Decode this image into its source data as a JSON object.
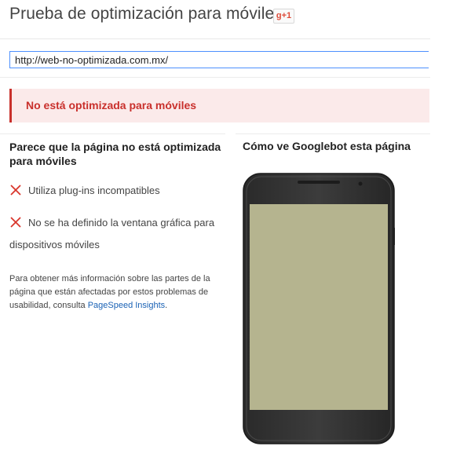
{
  "header": {
    "title": "Prueba de optimización para móviles",
    "gplus_label": "g+1"
  },
  "url_input": {
    "value": "http://web-no-optimizada.com.mx/"
  },
  "alert": {
    "text": "No está optimizada para móviles",
    "color": "#c9302c",
    "background": "#fbeaea"
  },
  "left": {
    "heading": "Parece que la página no está optimizada para móviles",
    "issues": [
      {
        "icon": "x-mark-icon",
        "text": "Utiliza plug-ins incompatibles"
      },
      {
        "icon": "x-mark-icon",
        "text": "No se ha definido la ventana gráfica para dispositivos móviles"
      }
    ],
    "info_text": "Para obtener más información sobre las partes de la página que están afectadas por estos problemas de usabilidad, consulta ",
    "info_link": "PageSpeed Insights",
    "info_end": "."
  },
  "right": {
    "heading": "Cómo ve Googlebot esta página",
    "phone_screen_color": "#b5b48f"
  },
  "colors": {
    "link": "#1a62b5",
    "error_icon": "#d9352b",
    "input_border": "#4d90fe"
  }
}
